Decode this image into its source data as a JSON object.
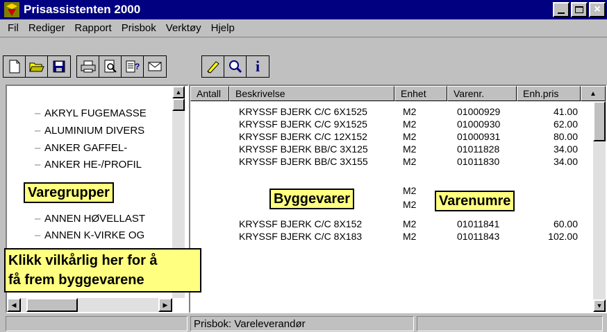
{
  "window": {
    "title": "Prisassistenten 2000",
    "controls": [
      "minimize",
      "maximize",
      "close"
    ]
  },
  "menu": [
    {
      "label": "Fil",
      "mnemonic": "F"
    },
    {
      "label": "Rediger",
      "mnemonic": "e"
    },
    {
      "label": "Rapport",
      "mnemonic": "R"
    },
    {
      "label": "Prisbok",
      "mnemonic": "b"
    },
    {
      "label": "Verktøy",
      "mnemonic": "V"
    },
    {
      "label": "Hjelp",
      "mnemonic": "H"
    }
  ],
  "toolbar": {
    "icons": [
      "new-file-icon",
      "open-folder-icon",
      "save-icon",
      "print-icon",
      "print-preview-icon",
      "report-help-icon",
      "mail-icon",
      "edit-pencil-icon",
      "search-icon",
      "info-icon"
    ]
  },
  "tree": {
    "items": [
      "AKRYL FUGEMASSE",
      "ALUMINIUM DIVERS",
      "ANKER GAFFEL-",
      "ANKER HE-/PROFIL",
      "ANNEN HØVELLAST",
      "ANNEN K-VIRKE OG"
    ]
  },
  "table": {
    "headers": [
      "Antall",
      "Beskrivelse",
      "Enhet",
      "Varenr.",
      "Enh.pris"
    ],
    "rows": [
      {
        "beskrivelse": "KRYSSF BJERK C/C  6X1525",
        "enhet": "M2",
        "varenr": "01000929",
        "pris": "41.00"
      },
      {
        "beskrivelse": "KRYSSF BJERK C/C  9X1525",
        "enhet": "M2",
        "varenr": "01000930",
        "pris": "62.00"
      },
      {
        "beskrivelse": "KRYSSF BJERK C/C 12X152",
        "enhet": "M2",
        "varenr": "01000931",
        "pris": "80.00"
      },
      {
        "beskrivelse": "KRYSSF BJERK BB/C  3X125",
        "enhet": "M2",
        "varenr": "01011828",
        "pris": "34.00"
      },
      {
        "beskrivelse": "KRYSSF BJERK BB/C  3X155",
        "enhet": "M2",
        "varenr": "01011830",
        "pris": "34.00"
      },
      {
        "beskrivelse": "",
        "enhet": "M2",
        "varenr": "",
        "pris": ""
      },
      {
        "beskrivelse": "",
        "enhet": "M2",
        "varenr": "",
        "pris": ""
      },
      {
        "beskrivelse": "KRYSSF BJERK C/C   8X152",
        "enhet": "M2",
        "varenr": "01011841",
        "pris": "60.00"
      },
      {
        "beskrivelse": "KRYSSF BJERK C/C   8X183",
        "enhet": "M2",
        "varenr": "01011843",
        "pris": "102.00"
      }
    ]
  },
  "callouts": {
    "varegrupper": "Varegrupper",
    "byggevarer": "Byggevarer",
    "varenumre": "Varenumre",
    "klikk_line1": "Klikk vilkårlig her for å",
    "klikk_line2": "få frem byggevarene"
  },
  "status": {
    "prisbok": "Prisbok: Vareleverandør"
  },
  "colors": {
    "titlebar": "#000080",
    "callout_bg": "#ffff80",
    "chrome": "#c0c0c0"
  }
}
